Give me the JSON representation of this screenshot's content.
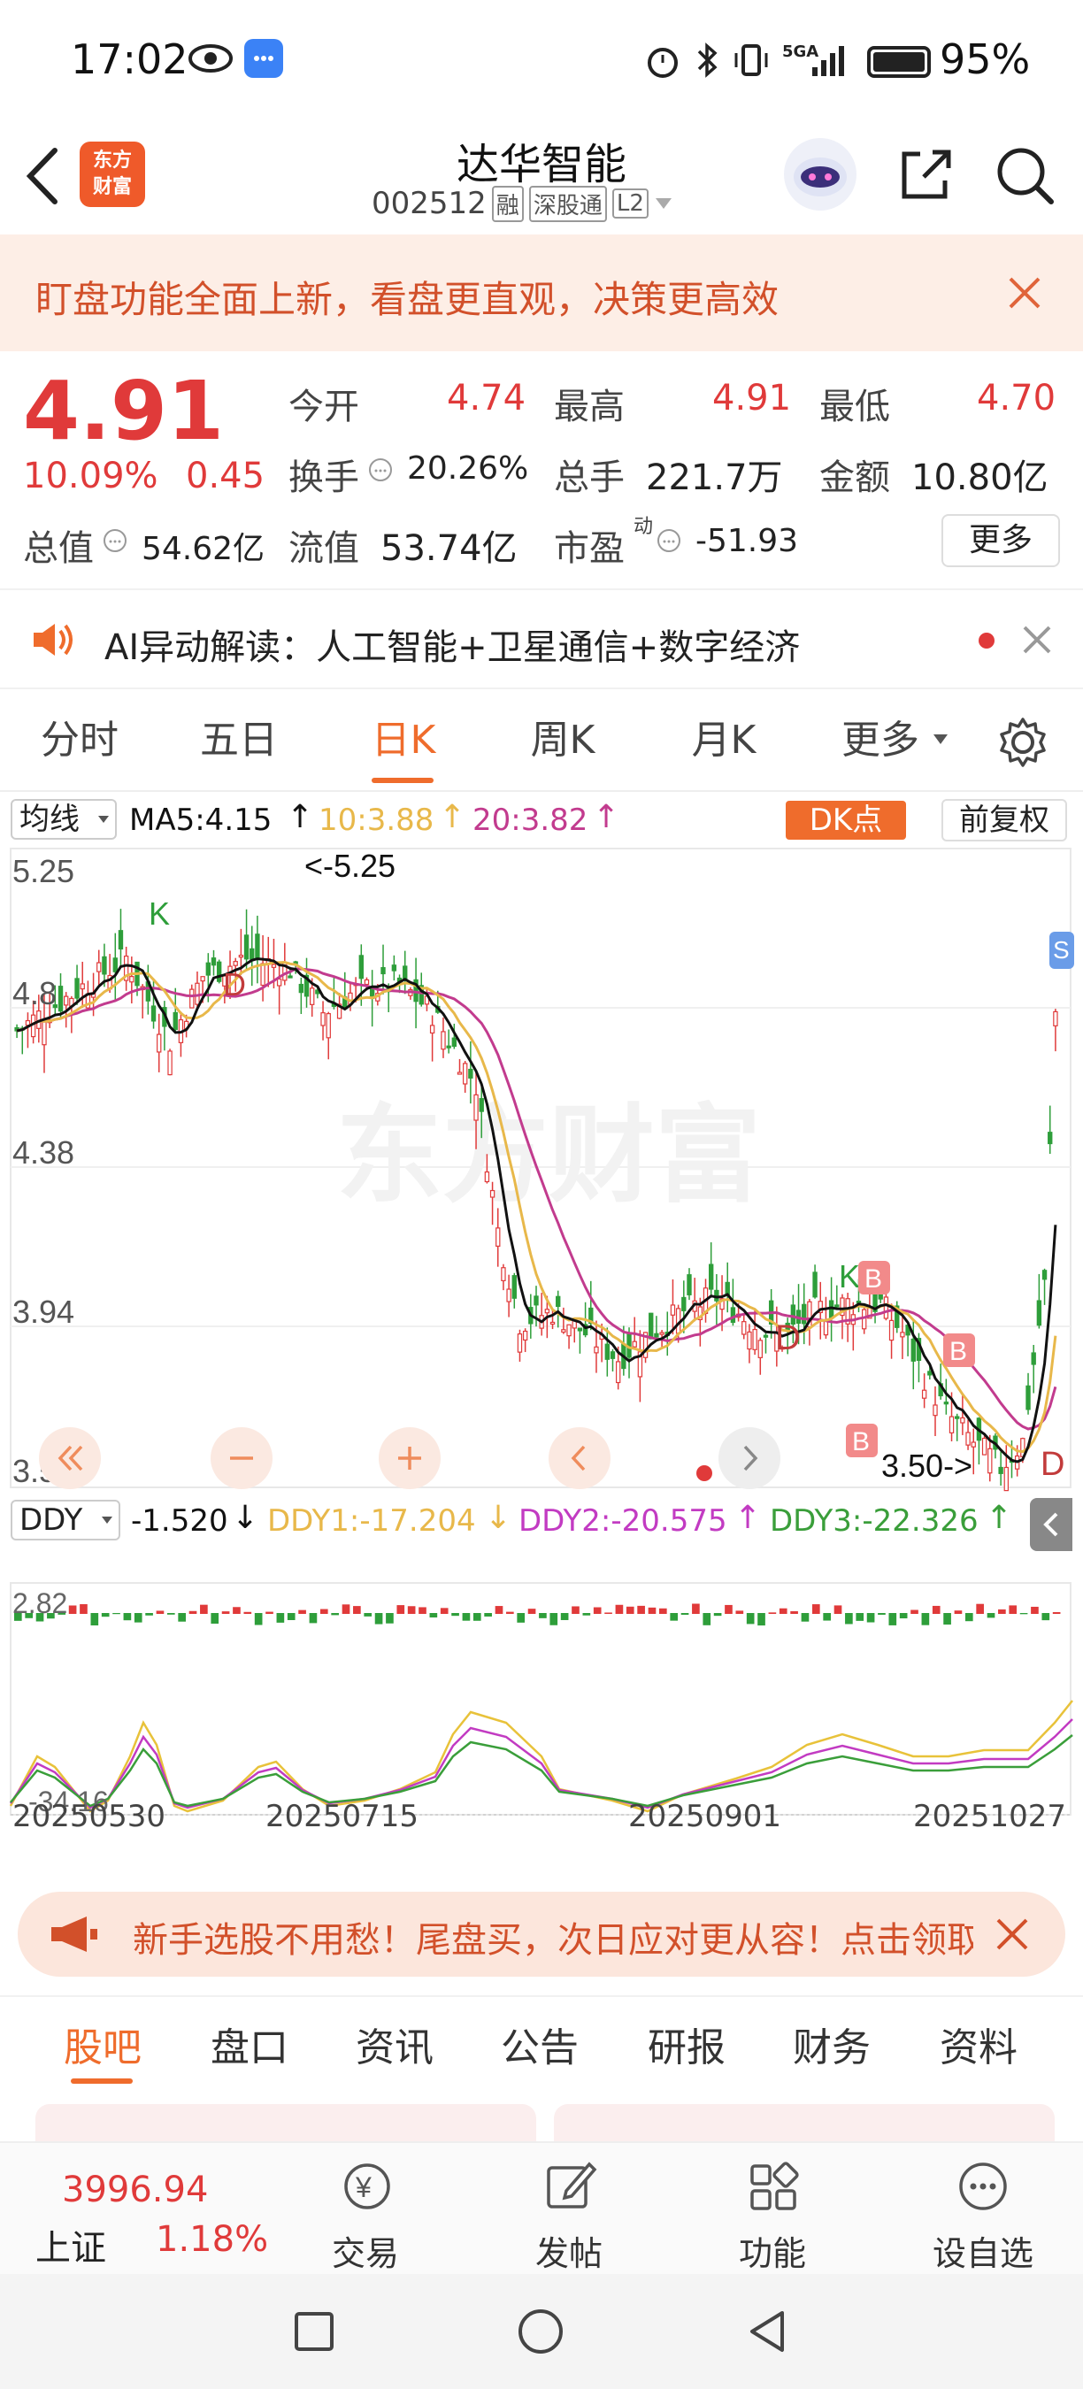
{
  "status_bar": {
    "time": "17:02",
    "battery": "95%",
    "network": "5GA"
  },
  "header": {
    "back_icon": "chevron-left-icon",
    "brand_logo": "东方\n财富",
    "stock_name": "达华智能",
    "stock_code": "002512",
    "badges": [
      "融",
      "深股通",
      "L2"
    ],
    "icons": [
      "robot-assistant-icon",
      "share-icon",
      "search-icon"
    ]
  },
  "banner": {
    "text": "盯盘功能全面上新，看盘更直观，决策更高效"
  },
  "quote": {
    "price": "4.91",
    "change_pct": "10.09%",
    "change": "0.45",
    "open_label": "今开",
    "open": "4.74",
    "high_label": "最高",
    "high": "4.91",
    "low_label": "最低",
    "low": "4.70",
    "turnover_label": "换手",
    "turnover": "20.26%",
    "volume_label": "总手",
    "volume": "221.7万",
    "amount_label": "金额",
    "amount": "10.80亿",
    "mktcap_label": "总值",
    "mktcap": "54.62亿",
    "float_label": "流值",
    "float_value": "53.74亿",
    "pe_label": "市盈",
    "pe_sup": "动",
    "pe": "-51.93",
    "more_button": "更多"
  },
  "ai_row": {
    "text": "AI异动解读：人工智能+卫星通信+数字经济"
  },
  "chart_tabs": {
    "items": [
      "分时",
      "五日",
      "日K",
      "周K",
      "月K",
      "更多"
    ],
    "active_index": 2
  },
  "indicator_bar": {
    "ma_select": "均线",
    "ma5": "MA5:4.15",
    "ma10": "10:3.88",
    "ma20": "20:3.82",
    "dk_button": "DK点",
    "adjust_button": "前复权"
  },
  "price_axis": {
    "labels": [
      "5.25",
      "4.8",
      "4.38",
      "3.94",
      "3.50"
    ],
    "max_label": "<-5.25",
    "min_label": "3.50->"
  },
  "ddy": {
    "select": "DDY",
    "ddy": "-1.520",
    "ddy1": "DDY1:-17.204",
    "ddy2": "DDY2:-20.575",
    "ddy3": "DDY3:-22.326",
    "max": "2.82",
    "min": "-34.16"
  },
  "dates": [
    "20250530",
    "20250715",
    "20250901",
    "20251027"
  ],
  "chart_markers": {
    "k": "K",
    "d": "D",
    "b": "B",
    "s": "S"
  },
  "watermark": "东方财富",
  "colors": {
    "up": "#e03a3a",
    "down": "#2e9e3a",
    "ma5": "#111111",
    "ma10": "#e8b84a",
    "ma20": "#c23b8e",
    "accent": "#ef6c2c"
  },
  "promo": {
    "text": "新手选股不用愁！尾盘买，次日应对更从容！点击领取"
  },
  "bottom_tabs": {
    "items": [
      "股吧",
      "盘口",
      "资讯",
      "公告",
      "研报",
      "财务",
      "资料"
    ],
    "active_index": 0
  },
  "bottom_nav": {
    "index_value": "3996.94",
    "index_name": "上证",
    "index_change": "1.18%",
    "items": [
      "交易",
      "发帖",
      "功能",
      "设自选"
    ]
  }
}
